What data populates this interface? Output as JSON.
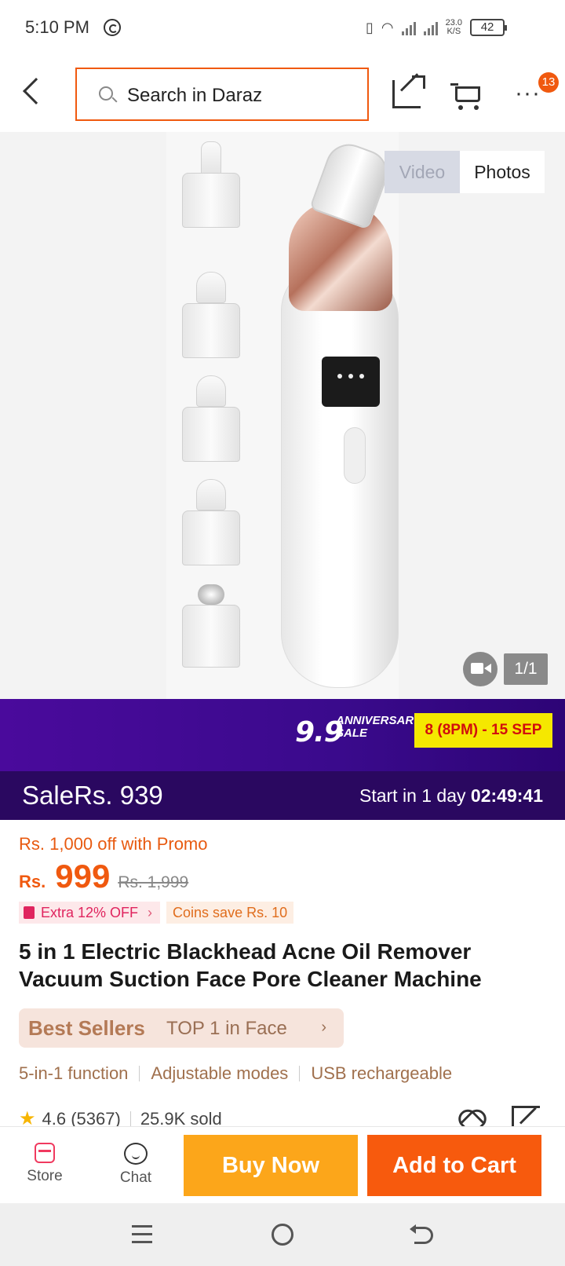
{
  "status_bar": {
    "time": "5:10 PM",
    "net_speed_value": "23.0",
    "net_speed_unit": "K/S",
    "battery": "42"
  },
  "header": {
    "search_placeholder": "Search in Daraz",
    "more_badge": "13"
  },
  "gallery": {
    "tab_video": "Video",
    "tab_photos": "Photos",
    "counter": "1/1"
  },
  "campaign": {
    "number": "9.9",
    "event": "ANNIVERSARY SALE",
    "date_range": "8 (8PM) - 15 SEP"
  },
  "sale": {
    "label": "Sale",
    "price": "Rs. 939",
    "start_prefix": "Start in 1 day ",
    "countdown": "02:49:41"
  },
  "pricing": {
    "promo": "Rs. 1,000 off with Promo",
    "currency": "Rs.",
    "amount": "999",
    "original": "Rs. 1,999",
    "extra_off": "Extra 12% OFF",
    "coins": "Coins save Rs. 10"
  },
  "product": {
    "title": "5 in 1 Electric Blackhead Acne Oil Remover Vacuum Suction Face Pore Cleaner Machine",
    "best_sellers_label": "Best Sellers",
    "best_sellers_rank": "TOP 1 in Face",
    "features": [
      "5-in-1 function",
      "Adjustable modes",
      "USB rechargeable"
    ],
    "rating": "4.6 (5367)",
    "sold": "25.9K sold"
  },
  "action_bar": {
    "store": "Store",
    "chat": "Chat",
    "buy_now": "Buy Now",
    "add_to_cart": "Add to Cart"
  },
  "colors": {
    "brand_orange": "#f0590f",
    "buy_now": "#fca61a",
    "campaign_purple": "#3a0a8c"
  }
}
